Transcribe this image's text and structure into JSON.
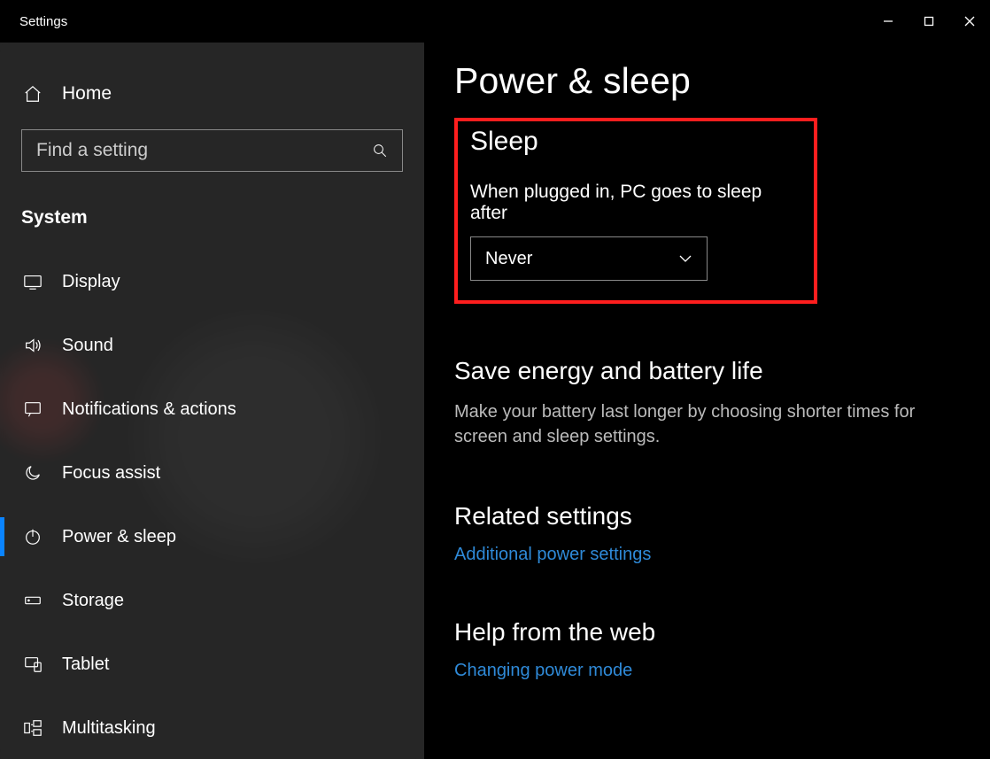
{
  "titlebar": {
    "title": "Settings"
  },
  "sidebar": {
    "home": "Home",
    "search_placeholder": "Find a setting",
    "group_label": "System",
    "items": [
      {
        "label": "Display"
      },
      {
        "label": "Sound"
      },
      {
        "label": "Notifications & actions"
      },
      {
        "label": "Focus assist"
      },
      {
        "label": "Power & sleep"
      },
      {
        "label": "Storage"
      },
      {
        "label": "Tablet"
      },
      {
        "label": "Multitasking"
      }
    ]
  },
  "main": {
    "page_title": "Power & sleep",
    "sleep": {
      "heading": "Sleep",
      "label": "When plugged in, PC goes to sleep after",
      "value": "Never"
    },
    "energy": {
      "heading": "Save energy and battery life",
      "body": "Make your battery last longer by choosing shorter times for screen and sleep settings."
    },
    "related": {
      "heading": "Related settings",
      "link": "Additional power settings"
    },
    "help": {
      "heading": "Help from the web",
      "link": "Changing power mode"
    }
  }
}
